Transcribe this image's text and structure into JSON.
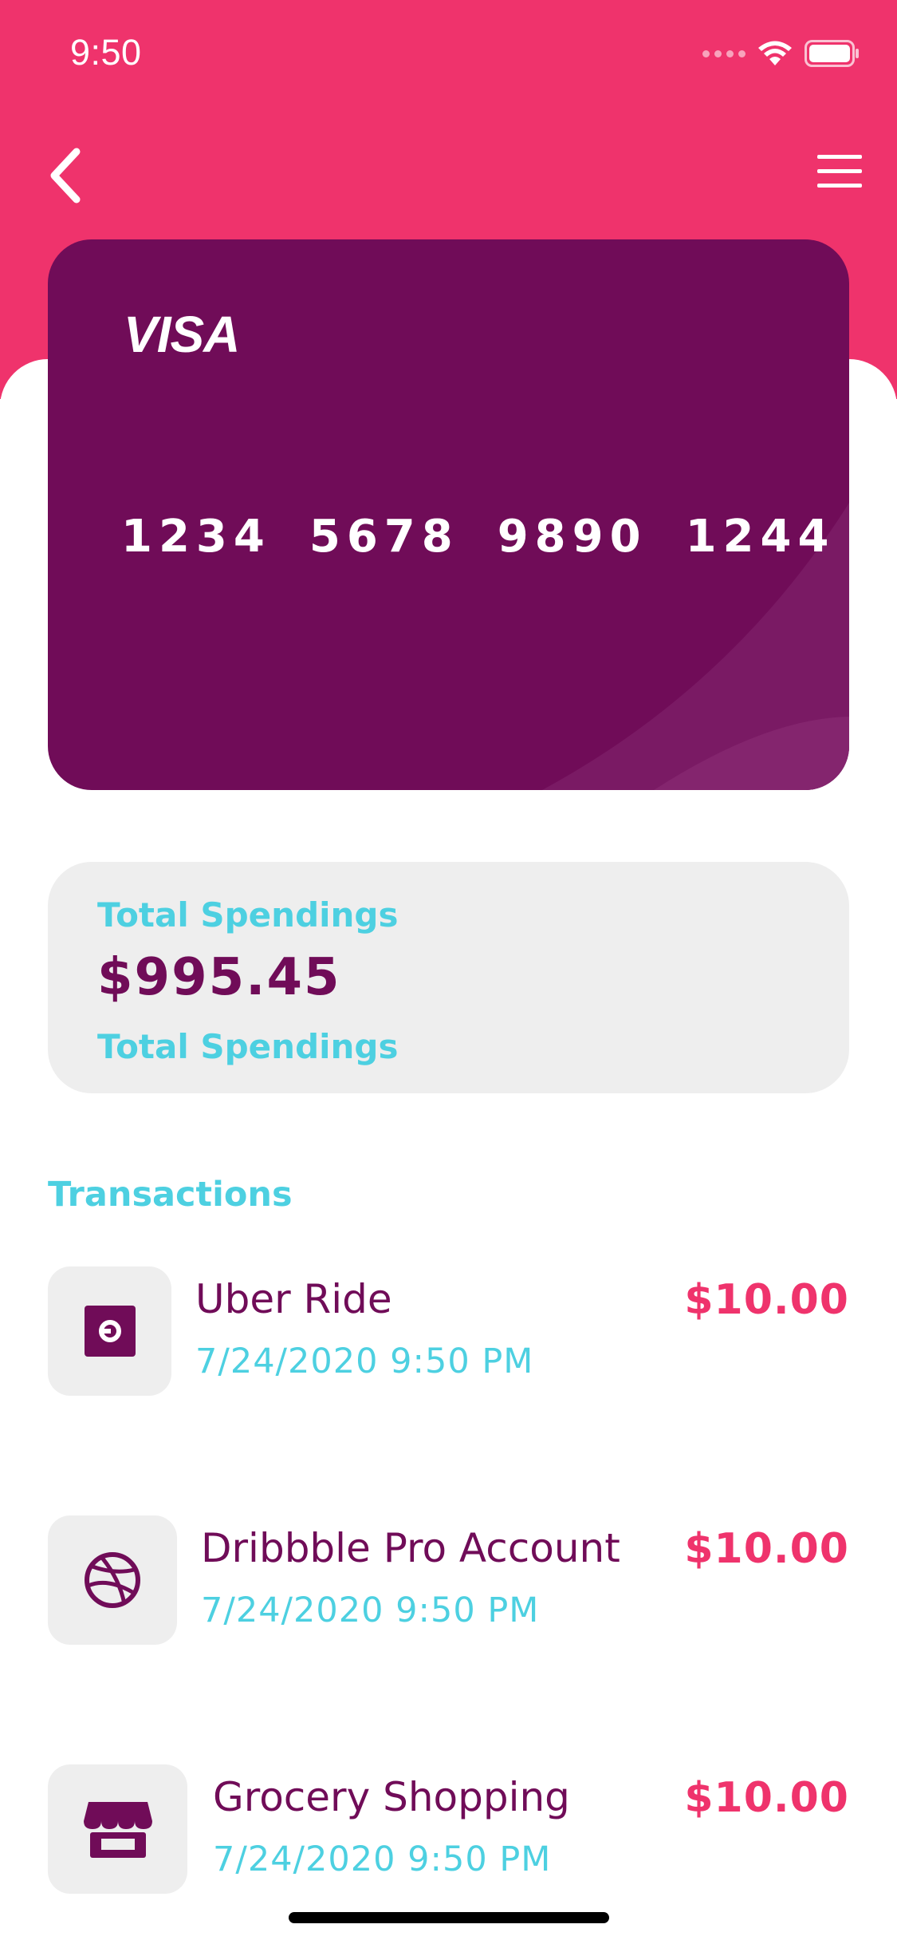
{
  "status_bar": {
    "time": "9:50"
  },
  "header": {
    "back_icon": "chevron-left-icon",
    "menu_icon": "hamburger-menu-icon"
  },
  "card": {
    "brand": "VISA",
    "number_groups": [
      "1234",
      "5678",
      "9890",
      "1244"
    ]
  },
  "spendings": {
    "label_top": "Total Spendings",
    "amount": "$995.45",
    "label_bottom": "Total Spendings"
  },
  "transactions": {
    "title": "Transactions",
    "items": [
      {
        "name": "Uber Ride",
        "date": "7/24/2020 9:50 PM",
        "amount": "$10.00",
        "icon": "uber-icon"
      },
      {
        "name": "Dribbble Pro Account",
        "date": "7/24/2020 9:50 PM",
        "amount": "$10.00",
        "icon": "dribbble-icon"
      },
      {
        "name": "Grocery Shopping",
        "date": "7/24/2020 9:50 PM",
        "amount": "$10.00",
        "icon": "store-icon"
      }
    ]
  },
  "colors": {
    "header_pink": "#EF336C",
    "card_purple": "#700C58",
    "accent_cyan": "#4DD0E1",
    "panel_gray": "#EEEEEE",
    "amount_pink": "#EF336C"
  }
}
